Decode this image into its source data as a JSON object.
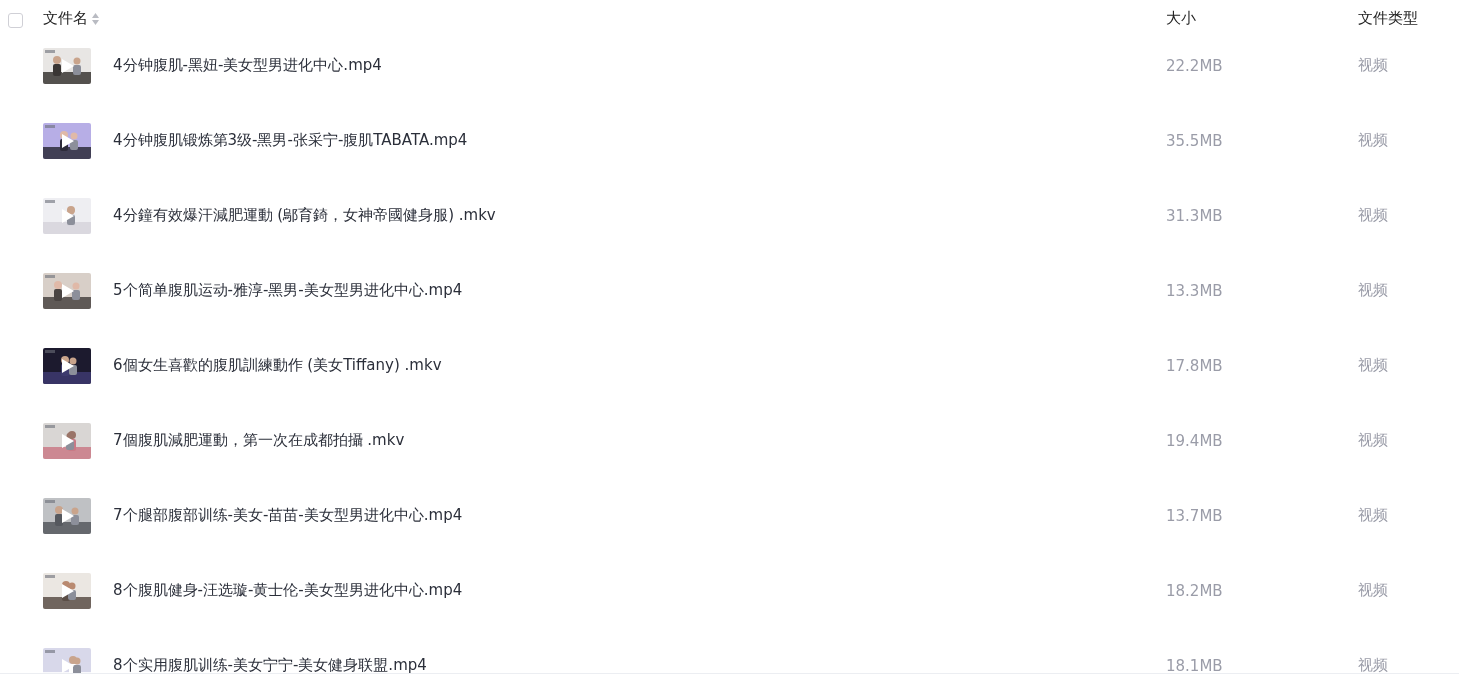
{
  "header": {
    "select_all": {
      "checked": false
    },
    "columns": [
      "文件名",
      "大小",
      "文件类型"
    ]
  },
  "rows": [
    {
      "name": "4分钟腹肌-黑妞-美女型男进化中心.mp4",
      "size": "22.2MB",
      "type": "视频"
    },
    {
      "name": "4分钟腹肌锻炼第3级-黑男-张采宁-腹肌TABATA.mp4",
      "size": "35.5MB",
      "type": "视频"
    },
    {
      "name": "4分鐘有效爆汗減肥運動 (鄔育錡，女神帝國健身服) .mkv",
      "size": "31.3MB",
      "type": "视频"
    },
    {
      "name": "5个简单腹肌运动-雅淳-黑男-美女型男进化中心.mp4",
      "size": "13.3MB",
      "type": "视频"
    },
    {
      "name": "6個女生喜歡的腹肌訓練動作 (美女Tiffany) .mkv",
      "size": "17.8MB",
      "type": "视频"
    },
    {
      "name": "7個腹肌減肥運動，第一次在成都拍攝 .mkv",
      "size": "19.4MB",
      "type": "视频"
    },
    {
      "name": "7个腿部腹部训练-美女-苗苗-美女型男进化中心.mp4",
      "size": "13.7MB",
      "type": "视频"
    },
    {
      "name": "8个腹肌健身-汪选璇-黄士伦-美女型男进化中心.mp4",
      "size": "18.2MB",
      "type": "视频"
    },
    {
      "name": "8个实用腹肌训练-美女宁宁-美女健身联盟.mp4",
      "size": "18.1MB",
      "type": "视频"
    }
  ]
}
